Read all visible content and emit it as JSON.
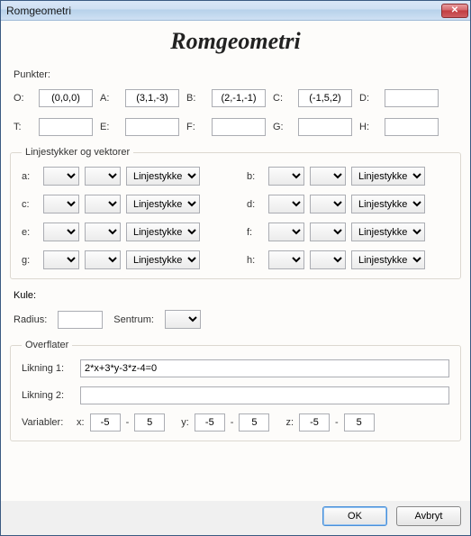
{
  "window": {
    "title": "Romgeometri"
  },
  "mainTitle": "Romgeometri",
  "points": {
    "heading": "Punkter:",
    "rows": [
      {
        "label": "O:",
        "value": "(0,0,0)"
      },
      {
        "label": "A:",
        "value": "(3,1,-3)"
      },
      {
        "label": "B:",
        "value": "(2,-1,-1)"
      },
      {
        "label": "C:",
        "value": "(-1,5,2)"
      },
      {
        "label": "D:",
        "value": ""
      },
      {
        "label": "T:",
        "value": ""
      },
      {
        "label": "E:",
        "value": ""
      },
      {
        "label": "F:",
        "value": ""
      },
      {
        "label": "G:",
        "value": ""
      },
      {
        "label": "H:",
        "value": ""
      }
    ]
  },
  "lines": {
    "legend": "Linjestykker og vektorer",
    "typeOption": "Linjestykke",
    "rows": [
      [
        "a:",
        "b:"
      ],
      [
        "c:",
        "d:"
      ],
      [
        "e:",
        "f:"
      ],
      [
        "g:",
        "h:"
      ]
    ]
  },
  "kule": {
    "heading": "Kule:",
    "radiusLabel": "Radius:",
    "radiusValue": "",
    "sentrumLabel": "Sentrum:"
  },
  "surfaces": {
    "legend": "Overflater",
    "eq1Label": "Likning 1:",
    "eq1Value": "2*x+3*y-3*z-4=0",
    "eq2Label": "Likning 2:",
    "eq2Value": "",
    "varsLabel": "Variabler:",
    "vars": {
      "x": {
        "label": "x:",
        "min": "-5",
        "max": "5"
      },
      "y": {
        "label": "y:",
        "min": "-5",
        "max": "5"
      },
      "z": {
        "label": "z:",
        "min": "-5",
        "max": "5"
      }
    }
  },
  "footer": {
    "ok": "OK",
    "cancel": "Avbryt"
  }
}
